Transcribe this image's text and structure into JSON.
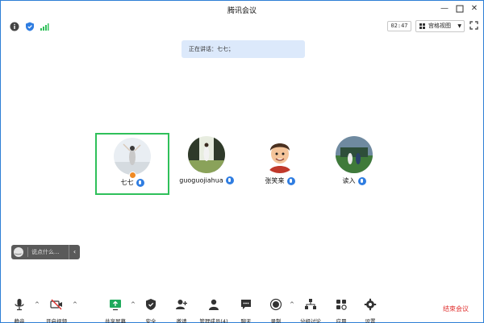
{
  "window": {
    "title": "腾讯会议",
    "controls": [
      "minimize",
      "maximize",
      "close"
    ]
  },
  "infobar": {
    "timer": "02:47",
    "view_label": "宫格视图"
  },
  "notice": {
    "text": "正在讲话：七七；"
  },
  "participants": [
    {
      "name": "七七",
      "is_host": true,
      "active_speaker": true
    },
    {
      "name": "guoguojiahua",
      "is_host": false,
      "active_speaker": false
    },
    {
      "name": "张笑来",
      "is_host": false,
      "active_speaker": false
    },
    {
      "name": "读入",
      "is_host": false,
      "active_speaker": false
    }
  ],
  "chat": {
    "placeholder": "说点什么..."
  },
  "toolbar": {
    "mute": "静音",
    "video": "开启视频",
    "share": "共享屏幕",
    "security": "安全",
    "invite": "邀请",
    "members": "管理成员(4)",
    "chat": "聊天",
    "record": "录制",
    "breakout": "分组讨论",
    "apps": "应用",
    "settings": "设置",
    "leave": "结束会议"
  },
  "colors": {
    "active_border": "#2fc05a",
    "mic_blue": "#2f7de1",
    "leave_red": "#e0312f",
    "notice_bg": "#dce9fb",
    "share_green": "#1faa5c"
  }
}
